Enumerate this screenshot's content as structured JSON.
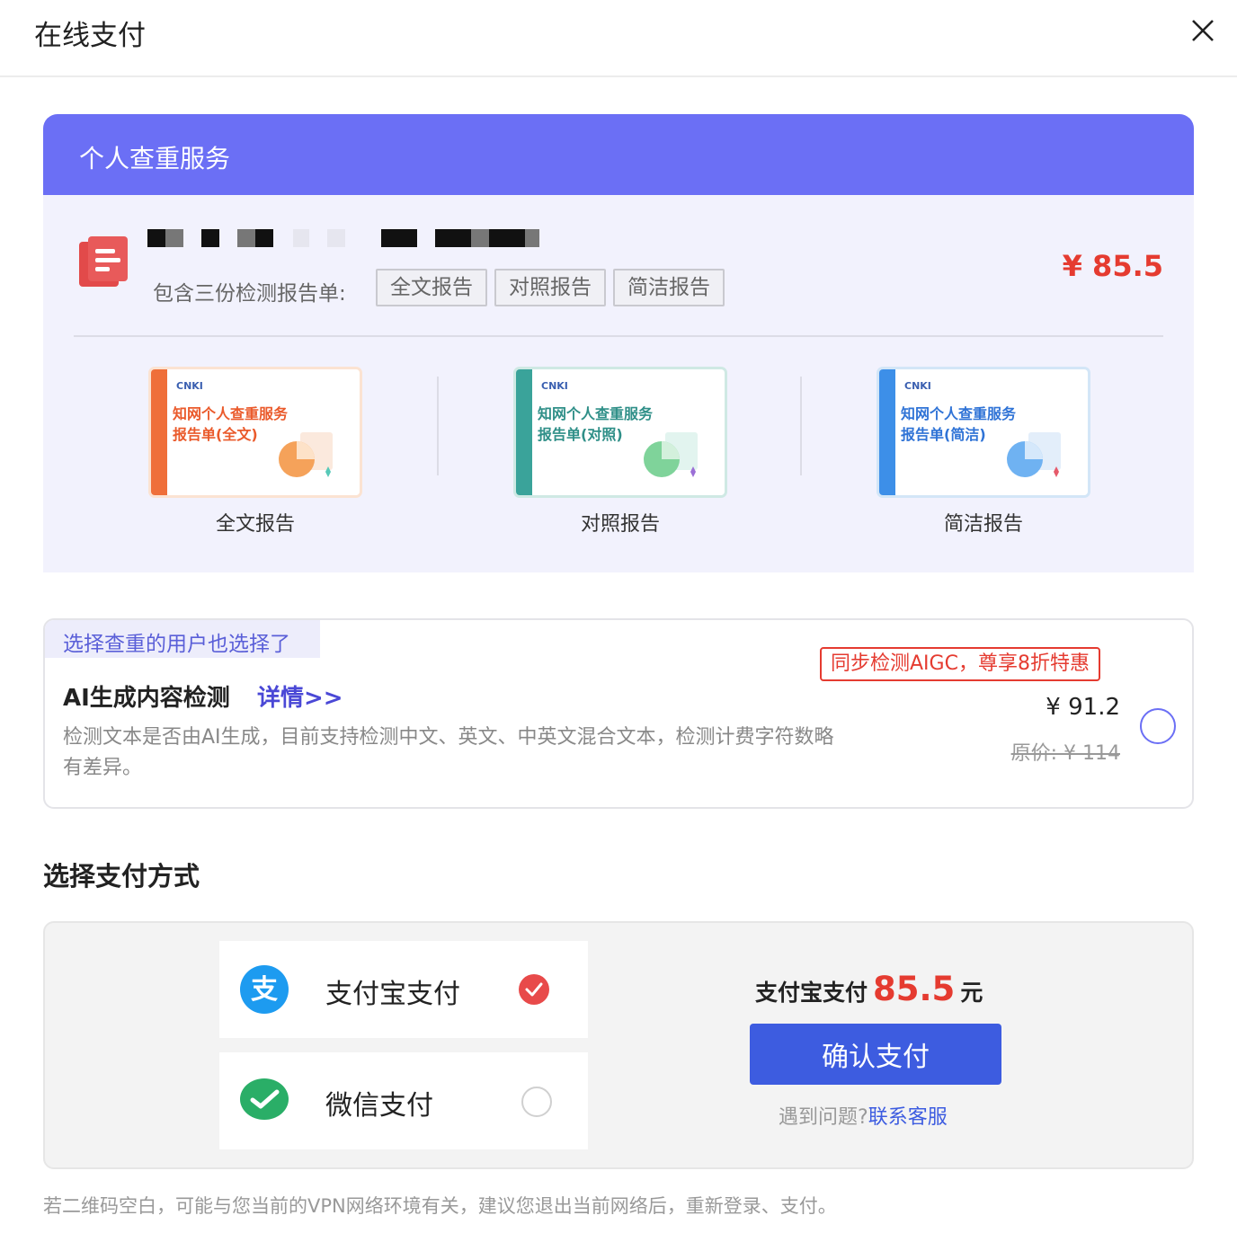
{
  "dialog": {
    "title": "在线支付",
    "close_icon": "close-icon"
  },
  "service": {
    "header": "个人查重服务",
    "icon": "document-icon",
    "includes_label": "包含三份检测报告单:",
    "tags": [
      "全文报告",
      "对照报告",
      "简洁报告"
    ],
    "price": "¥ 85.5",
    "reports": [
      {
        "logo": "CNKI",
        "title_line1": "知网个人查重服务",
        "title_line2": "报告单(全文)",
        "label": "全文报告",
        "stripe_color": "#ef6f3a",
        "title_color": "#ea5a2b",
        "pie_color": "#f5a25a"
      },
      {
        "logo": "CNKI",
        "title_line1": "知网个人查重服务",
        "title_line2": "报告单(对照)",
        "label": "对照报告",
        "stripe_color": "#3aa39a",
        "title_color": "#2f8f88",
        "pie_color": "#7fd39a"
      },
      {
        "logo": "CNKI",
        "title_line1": "知网个人查重服务",
        "title_line2": "报告单(简洁)",
        "label": "简洁报告",
        "stripe_color": "#3d8fe8",
        "title_color": "#2f73d6",
        "pie_color": "#6fb2f2"
      }
    ]
  },
  "aigc": {
    "tag": "选择查重的用户也选择了",
    "title": "AI生成内容检测",
    "detail_link": "详情>>",
    "description": "检测文本是否由AI生成，目前支持检测中文、英文、中英文混合文本，检测计费字符数略有差异。",
    "promo": "同步检测AIGC，尊享8折特惠",
    "price": "¥ 91.2",
    "original_price": "原价: ¥ 114",
    "selected": false
  },
  "payment": {
    "heading": "选择支付方式",
    "methods": [
      {
        "label": "支付宝支付",
        "icon": "alipay-icon",
        "selected": true
      },
      {
        "label": "微信支付",
        "icon": "wechat-pay-icon",
        "selected": false
      }
    ],
    "summary_prefix": "支付宝支付",
    "summary_amount": "85.5",
    "summary_unit": "元",
    "confirm_label": "确认支付",
    "help_text": "遇到问题?",
    "help_link": "联系客服"
  },
  "footnote": "若二维码空白，可能与您当前的VPN网络环境有关，建议您退出当前网络后，重新登录、支付。",
  "colors": {
    "accent": "#6b6ff5",
    "price_red": "#e53b30",
    "button_blue": "#3d5ce0"
  }
}
